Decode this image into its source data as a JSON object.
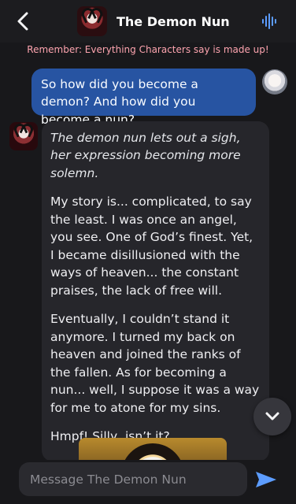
{
  "header": {
    "title": "The Demon Nun",
    "back_icon": "chevron-left-icon",
    "voice_icon": "voice-wave-icon"
  },
  "notice": "Remember: Everything Characters say is made up!",
  "messages": [
    {
      "role": "user",
      "text": "So how did you become a demon? And how did you become a nun?"
    },
    {
      "role": "character",
      "paragraphs": [
        "The demon nun lets out a sigh, her expression becoming more solemn.",
        "My story is... complicated, to say the least. I was once an angel, you see. One of God’s finest. Yet, I became disillusioned with the ways of heaven... the constant praises, the lack of free will.",
        "Eventually, I couldn’t stand it anymore. I turned my back on heaven and joined the ranks of the fallen. As for becoming a nun... well, I suppose it was a way for me to atone for my sins.",
        "Hmpf! Silly, isn’t it?"
      ]
    }
  ],
  "composer": {
    "placeholder": "Message The Demon Nun"
  },
  "colors": {
    "background": "#18181b",
    "user_bubble": "#2754a2",
    "character_bubble": "#26262b",
    "accent": "#5c9cff",
    "notice": "#fda4af"
  }
}
